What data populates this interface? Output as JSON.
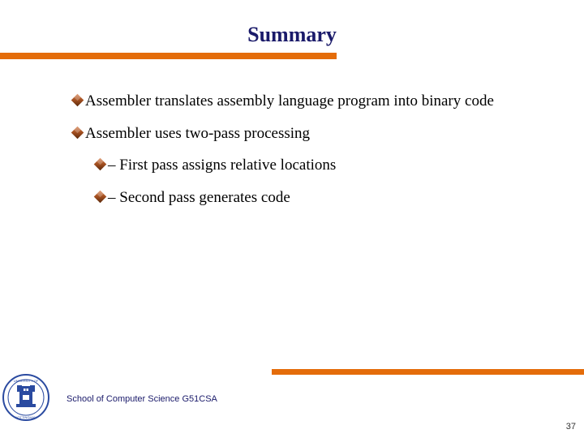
{
  "title": "Summary",
  "bullets": {
    "b1": "Assembler translates assembly language program into binary code",
    "b2": "Assembler uses two-pass processing",
    "b3": "– First pass assigns relative locations",
    "b4": "– Second pass generates code"
  },
  "footer": "School of Computer Science G51CSA",
  "page_number": "37",
  "colors": {
    "accent": "#e46c0a",
    "title": "#1a1a6a"
  }
}
